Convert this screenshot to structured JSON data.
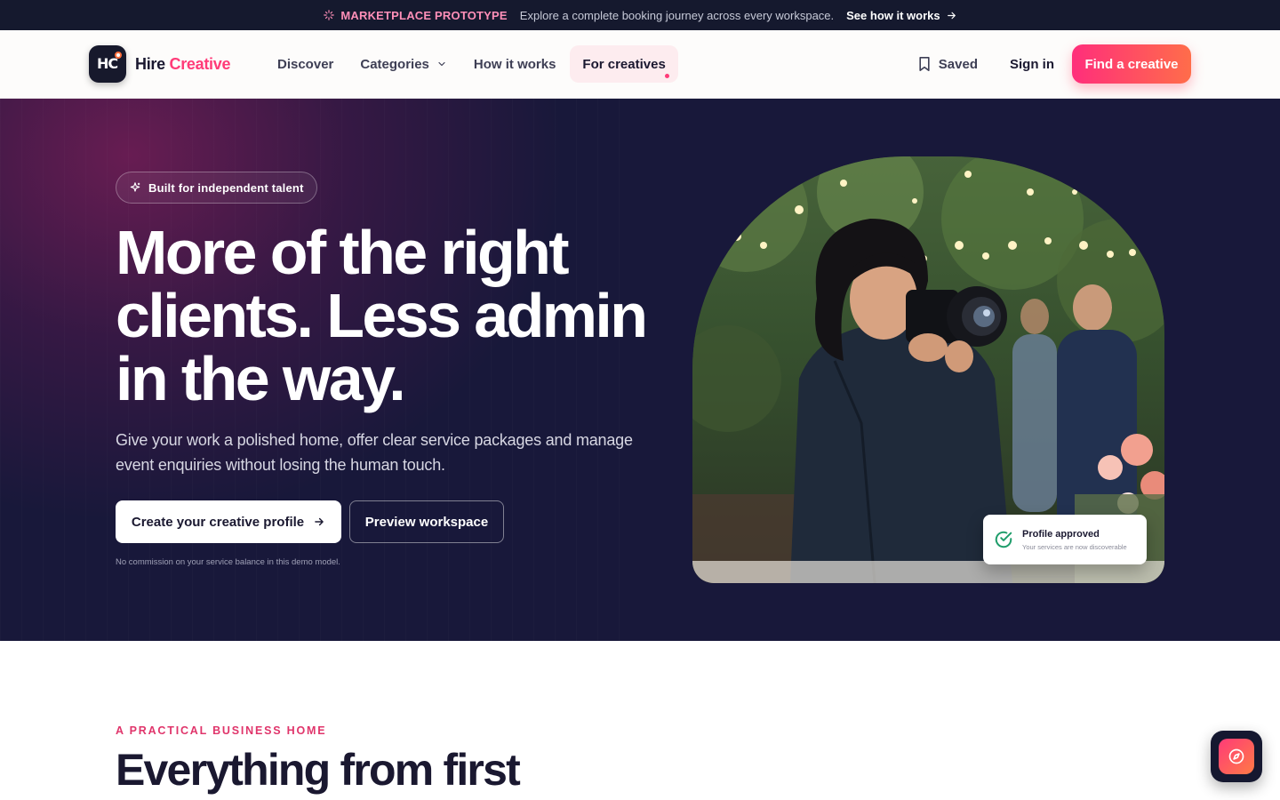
{
  "announcement": {
    "tag": "MARKETPLACE PROTOTYPE",
    "message": "Explore a complete booking journey across every workspace.",
    "link": "See how it works",
    "tag_icon": "sparkle-icon",
    "link_icon": "arrow-right-icon"
  },
  "header": {
    "logo_mark": "HC",
    "brand_primary": "Hire",
    "brand_accent": "Creative",
    "nav": [
      {
        "label": "Discover"
      },
      {
        "label": "Categories",
        "icon": "chevron-down-icon"
      },
      {
        "label": "How it works"
      },
      {
        "label": "For creatives",
        "active": true
      }
    ],
    "saved_label": "Saved",
    "signin_label": "Sign in",
    "cta_label": "Find a creative"
  },
  "hero": {
    "pill_label": "Built for independent talent",
    "headline": "More of the right clients. Less admin in the way.",
    "subcopy": "Give your work a polished home, offer clear service packages and manage event enquiries without losing the human touch.",
    "primary_button": "Create your creative profile",
    "secondary_button": "Preview workspace",
    "note": "No commission on your service balance in this demo model.",
    "badge_title": "Profile approved",
    "badge_subtitle": "Your services are now discoverable"
  },
  "section": {
    "eyebrow": "A PRACTICAL BUSINESS HOME",
    "title": "Everything from first"
  },
  "fab": {
    "icon": "compass-icon"
  },
  "colors": {
    "brand_pink": "#ff3b78",
    "brand_orange": "#ff6d4a",
    "hero_bg": "#18183a",
    "announce_bg": "#15192e",
    "success_green": "#1f9d6b"
  }
}
